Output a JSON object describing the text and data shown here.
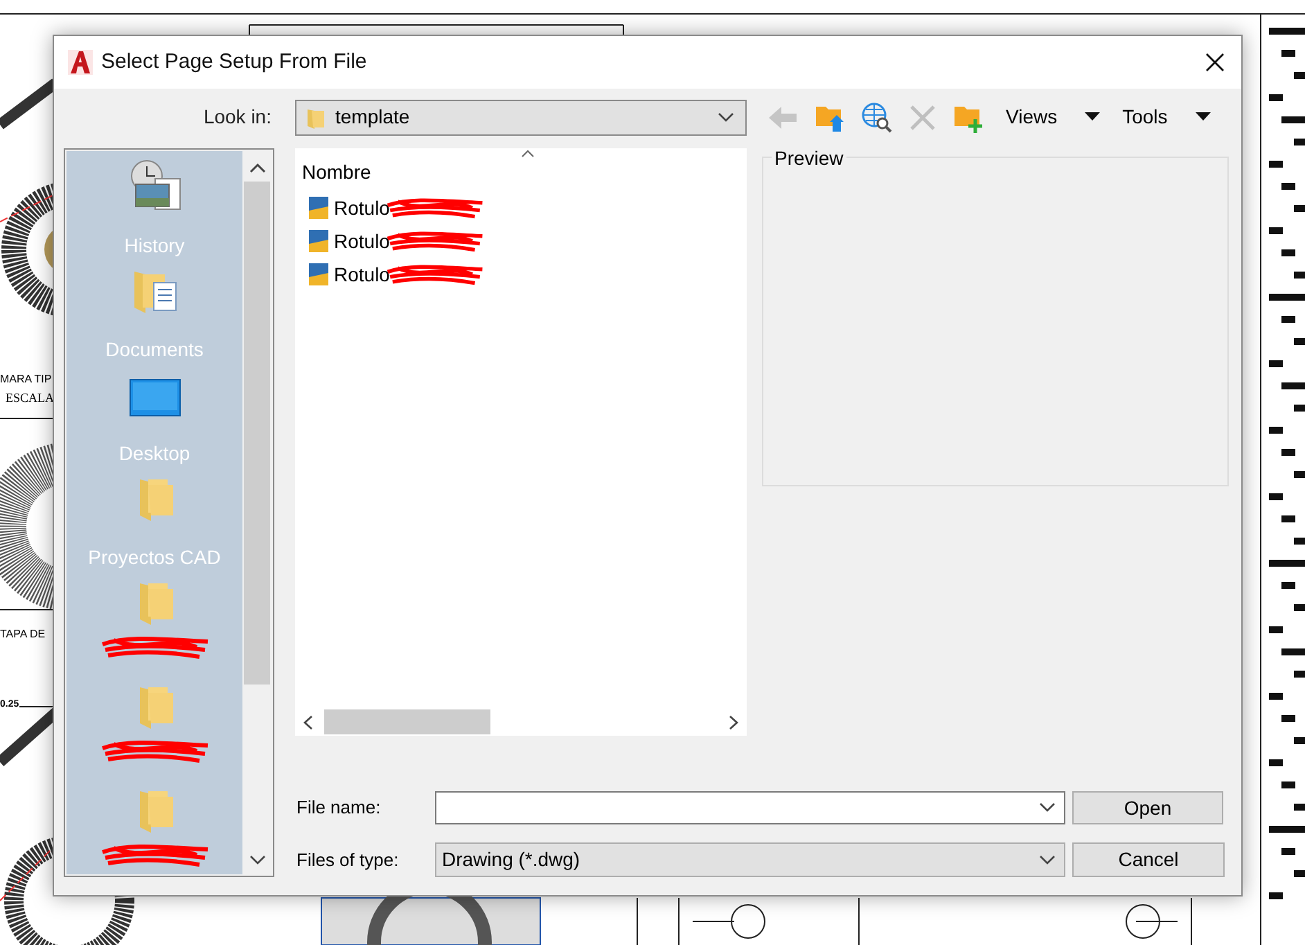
{
  "background": {
    "labels": [
      {
        "text": "MARA TIP",
        "kind": "small"
      },
      {
        "text": "ESCALA",
        "kind": "large"
      },
      {
        "text": "TAPA DE",
        "kind": "small"
      },
      {
        "text": "0.25",
        "kind": "tiny"
      }
    ]
  },
  "dialog": {
    "title": "Select Page Setup From File",
    "look_in": {
      "label": "Look in:",
      "value": "template"
    },
    "toolbar": [
      {
        "kind": "back",
        "disabled": true
      },
      {
        "kind": "up",
        "disabled": false
      },
      {
        "kind": "web",
        "disabled": false
      },
      {
        "kind": "delete",
        "disabled": true
      },
      {
        "kind": "new-folder",
        "disabled": false
      }
    ],
    "menus": [
      {
        "label": "Views"
      },
      {
        "label": "Tools"
      }
    ],
    "places": [
      {
        "kind": "history",
        "label": "History",
        "redacted": false
      },
      {
        "kind": "documents",
        "label": "Documents",
        "redacted": false
      },
      {
        "kind": "desktop",
        "label": "Desktop",
        "redacted": false
      },
      {
        "kind": "folder",
        "label": "Proyectos CAD",
        "redacted": false
      },
      {
        "kind": "folder",
        "redacted": true
      },
      {
        "kind": "folder",
        "redacted": true
      },
      {
        "kind": "folder",
        "redacted": true
      }
    ],
    "file_list": {
      "column": "Nombre",
      "files": [
        {
          "name": "Rotulo",
          "redacted": true
        },
        {
          "name": "Rotulo",
          "redacted": true
        },
        {
          "name": "Rotulo",
          "redacted": true
        }
      ]
    },
    "preview": {
      "label": "Preview"
    },
    "file_name": {
      "label": "File name:"
    },
    "file_type": {
      "label": "Files of type:",
      "value": "Drawing (*.dwg)"
    },
    "buttons": [
      {
        "label": "Open"
      },
      {
        "label": "Cancel"
      }
    ]
  }
}
